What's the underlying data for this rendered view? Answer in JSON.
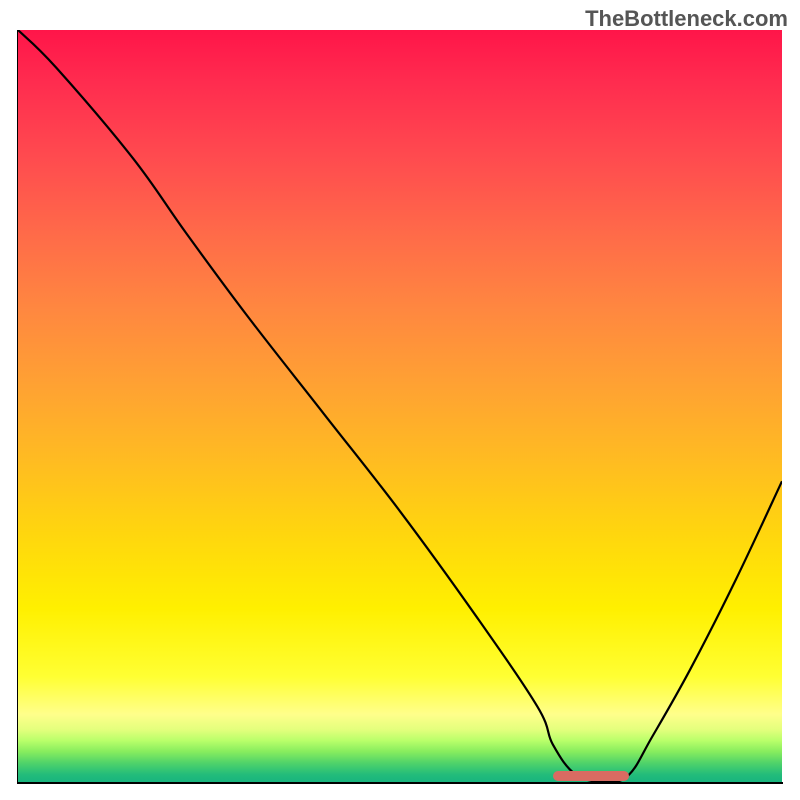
{
  "watermark": "TheBottleneck.com",
  "chart_data": {
    "type": "line",
    "title": "",
    "xlabel": "",
    "ylabel": "",
    "xlim": [
      0,
      100
    ],
    "ylim": [
      0,
      100
    ],
    "series": [
      {
        "name": "curve",
        "x": [
          0,
          5,
          15,
          22,
          30,
          40,
          50,
          60,
          68,
          70,
          73,
          77,
          80,
          83,
          88,
          94,
          100
        ],
        "values": [
          100,
          95,
          83,
          73,
          62,
          49,
          36,
          22,
          10,
          5,
          1,
          0,
          1,
          6,
          15,
          27,
          40
        ]
      }
    ],
    "marker": {
      "x_start": 70,
      "x_end": 80,
      "y": 0.8
    },
    "gradient_note": "background encodes score: red=high bottleneck, green=optimal"
  }
}
